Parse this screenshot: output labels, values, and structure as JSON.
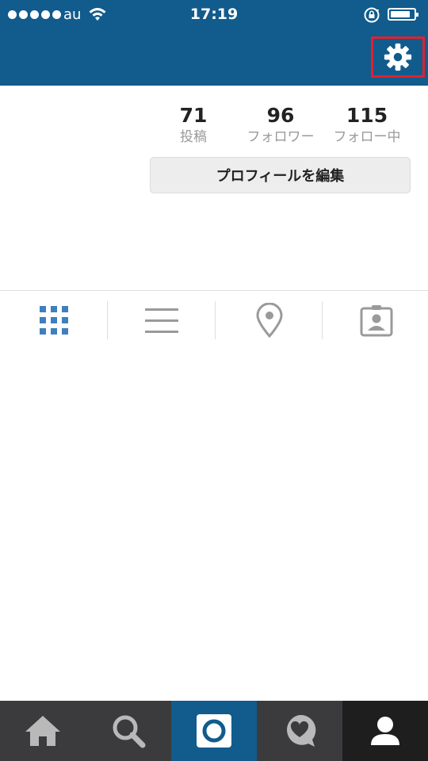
{
  "status_bar": {
    "carrier": "au",
    "time": "17:19",
    "battery_level": 0.75
  },
  "header": {
    "settings_icon": "gear-icon",
    "highlight_color": "#e0212e",
    "background_color": "#115b8d"
  },
  "stats": {
    "posts": {
      "count": "71",
      "label": "投稿"
    },
    "followers": {
      "count": "96",
      "label": "フォロワー"
    },
    "following": {
      "count": "115",
      "label": "フォロー中"
    }
  },
  "profile": {
    "edit_button_label": "プロフィールを編集"
  },
  "tabs": [
    {
      "icon": "grid-icon",
      "active": true,
      "color": "#3f7fc0"
    },
    {
      "icon": "list-icon",
      "active": false
    },
    {
      "icon": "location-pin-icon",
      "active": false
    },
    {
      "icon": "tagged-photos-icon",
      "active": false
    }
  ],
  "bottom_nav": [
    {
      "icon": "home-icon"
    },
    {
      "icon": "search-icon"
    },
    {
      "icon": "camera-icon",
      "active": true
    },
    {
      "icon": "activity-heart-icon"
    },
    {
      "icon": "profile-icon"
    }
  ]
}
